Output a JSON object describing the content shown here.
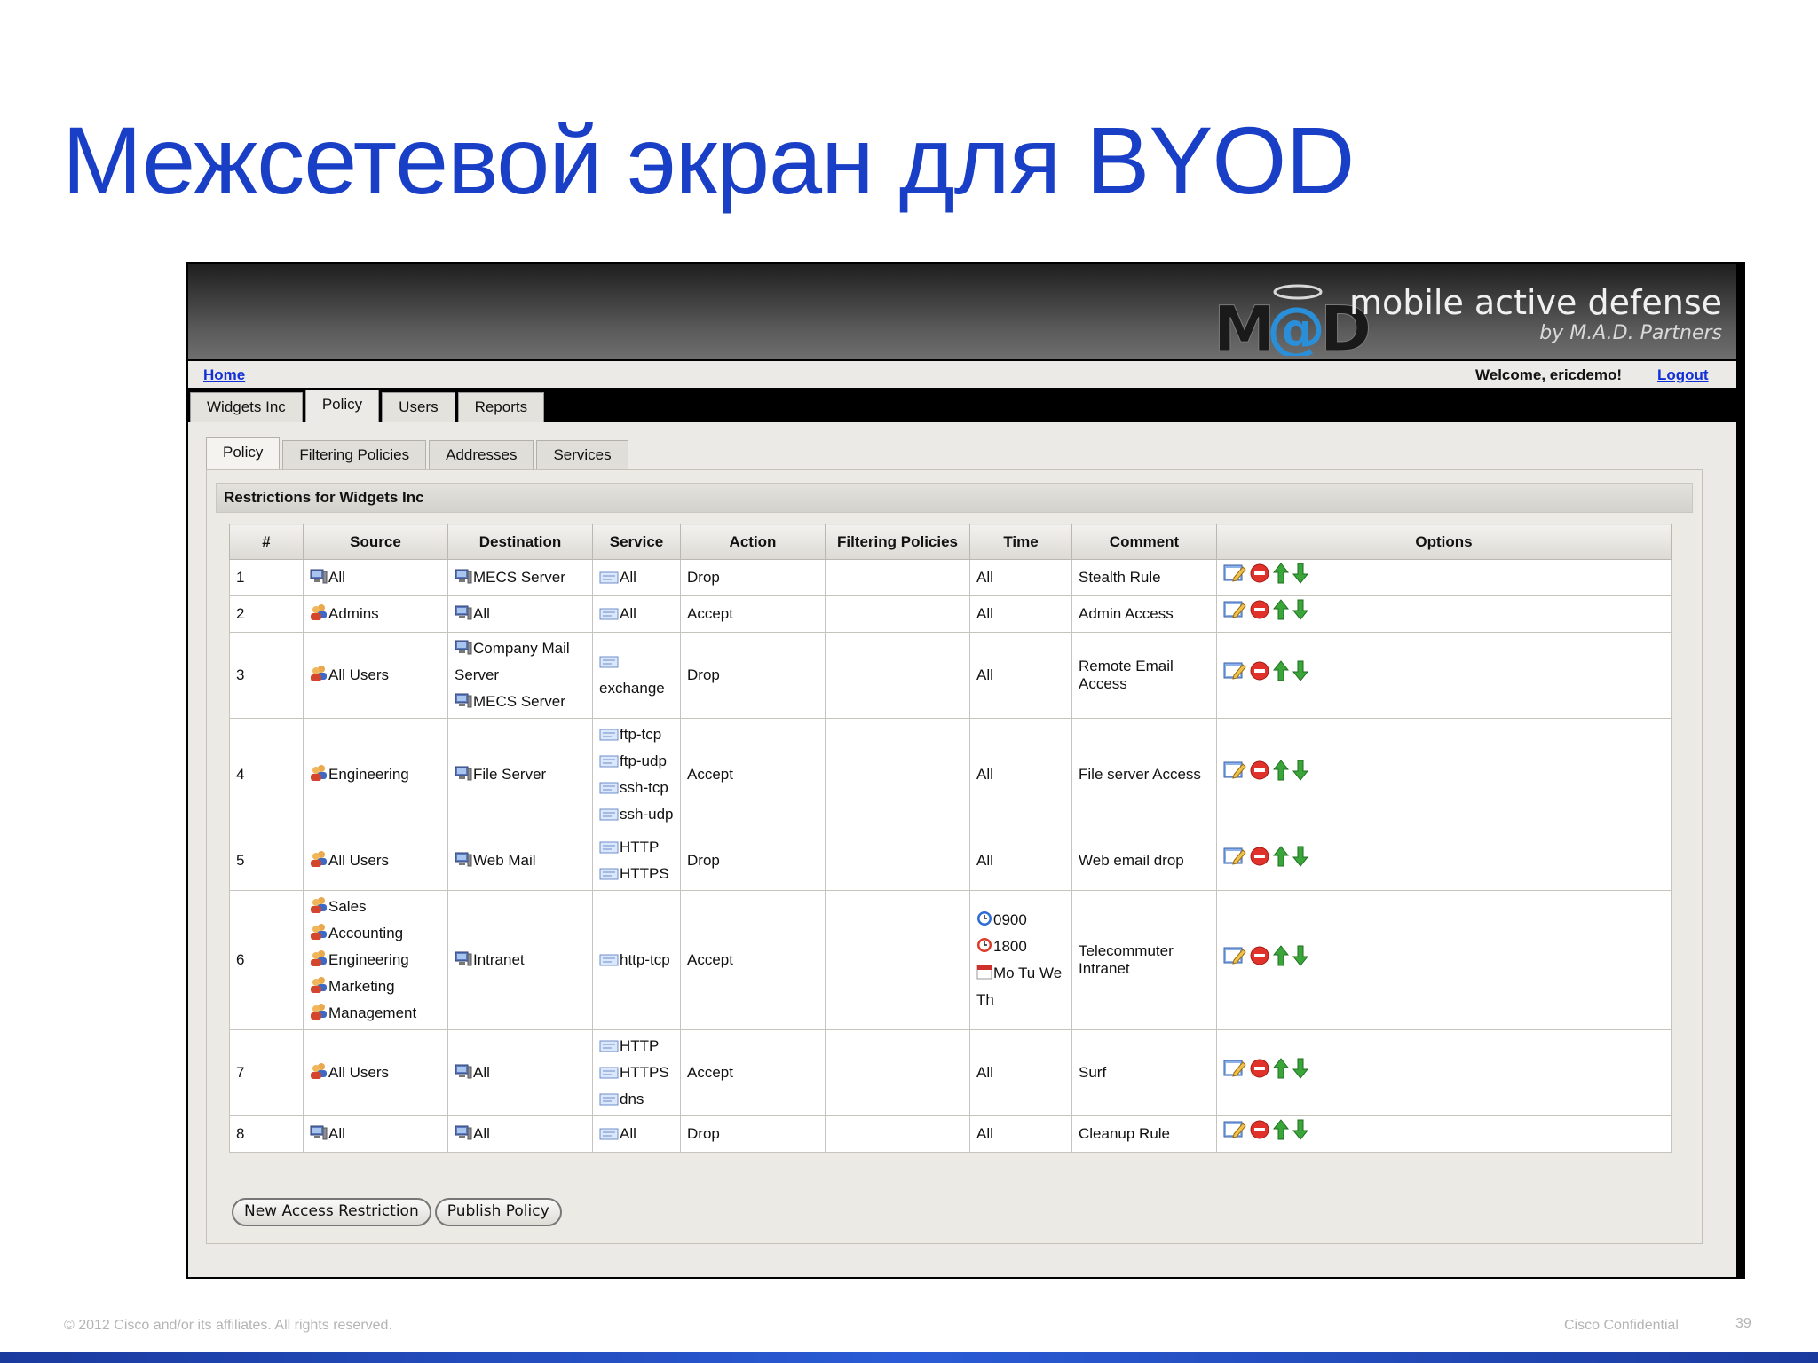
{
  "slide": {
    "title": "Межсетевой экран для BYOD",
    "footer_copyright": "© 2012 Cisco and/or its affiliates. All rights reserved.",
    "footer_confidential": "Cisco Confidential",
    "page_number": "39"
  },
  "app": {
    "logo_mark": "M@D",
    "logo_text": "mobile active defense",
    "logo_subtext": "by M.A.D. Partners",
    "home_link": "Home",
    "welcome": "Welcome, ericdemo!",
    "logout_link": "Logout",
    "top_tabs": [
      "Widgets Inc",
      "Policy",
      "Users",
      "Reports"
    ],
    "active_top_tab": "Policy",
    "sub_tabs": [
      "Policy",
      "Filtering Policies",
      "Addresses",
      "Services"
    ],
    "active_sub_tab": "Policy",
    "panel_title": "Restrictions for Widgets Inc",
    "columns": [
      "#",
      "Source",
      "Destination",
      "Service",
      "Action",
      "Filtering Policies",
      "Time",
      "Comment",
      "Options"
    ],
    "rows": [
      {
        "num": "1",
        "source": [
          {
            "icon": "computer-icon",
            "text": "All"
          }
        ],
        "destination": [
          {
            "icon": "computer-icon",
            "text": "MECS Server"
          }
        ],
        "service": [
          {
            "icon": "service-icon",
            "text": "All"
          }
        ],
        "action": "Drop",
        "filtering": "",
        "time": [
          {
            "icon": "",
            "text": "All"
          }
        ],
        "comment": "Stealth Rule"
      },
      {
        "num": "2",
        "source": [
          {
            "icon": "users-icon",
            "text": "Admins"
          }
        ],
        "destination": [
          {
            "icon": "computer-icon",
            "text": "All"
          }
        ],
        "service": [
          {
            "icon": "service-icon",
            "text": "All"
          }
        ],
        "action": "Accept",
        "filtering": "",
        "time": [
          {
            "icon": "",
            "text": "All"
          }
        ],
        "comment": "Admin Access"
      },
      {
        "num": "3",
        "source": [
          {
            "icon": "users-icon",
            "text": "All Users"
          }
        ],
        "destination": [
          {
            "icon": "computer-icon",
            "text": "Company Mail"
          },
          {
            "icon": "",
            "text": "Server"
          },
          {
            "icon": "computer-icon",
            "text": "MECS Server"
          }
        ],
        "service": [
          {
            "icon": "service-icon",
            "text": ""
          },
          {
            "icon": "",
            "text": "exchange"
          }
        ],
        "action": "Drop",
        "filtering": "",
        "time": [
          {
            "icon": "",
            "text": "All"
          }
        ],
        "comment": "Remote Email Access"
      },
      {
        "num": "4",
        "source": [
          {
            "icon": "users-icon",
            "text": "Engineering"
          }
        ],
        "destination": [
          {
            "icon": "computer-icon",
            "text": "File Server"
          }
        ],
        "service": [
          {
            "icon": "service-icon",
            "text": "ftp-tcp"
          },
          {
            "icon": "service-icon",
            "text": "ftp-udp"
          },
          {
            "icon": "service-icon",
            "text": "ssh-tcp"
          },
          {
            "icon": "service-icon",
            "text": "ssh-udp"
          }
        ],
        "action": "Accept",
        "filtering": "",
        "time": [
          {
            "icon": "",
            "text": "All"
          }
        ],
        "comment": "File server Access"
      },
      {
        "num": "5",
        "source": [
          {
            "icon": "users-icon",
            "text": "All Users"
          }
        ],
        "destination": [
          {
            "icon": "computer-icon",
            "text": "Web Mail"
          }
        ],
        "service": [
          {
            "icon": "service-icon",
            "text": "HTTP"
          },
          {
            "icon": "service-icon",
            "text": "HTTPS"
          }
        ],
        "action": "Drop",
        "filtering": "",
        "time": [
          {
            "icon": "",
            "text": "All"
          }
        ],
        "comment": "Web email drop"
      },
      {
        "num": "6",
        "source": [
          {
            "icon": "users-icon",
            "text": "Sales"
          },
          {
            "icon": "users-icon",
            "text": "Accounting"
          },
          {
            "icon": "users-icon",
            "text": "Engineering"
          },
          {
            "icon": "users-icon",
            "text": "Marketing"
          },
          {
            "icon": "users-icon",
            "text": "Management"
          }
        ],
        "destination": [
          {
            "icon": "computer-icon",
            "text": "Intranet"
          }
        ],
        "service": [
          {
            "icon": "service-icon",
            "text": "http-tcp"
          }
        ],
        "action": "Accept",
        "filtering": "",
        "time": [
          {
            "icon": "clock-blue-icon",
            "text": "0900"
          },
          {
            "icon": "clock-red-icon",
            "text": "1800"
          },
          {
            "icon": "calendar-icon",
            "text": "Mo Tu We"
          },
          {
            "icon": "",
            "text": "Th"
          }
        ],
        "comment": "Telecommuter Intranet"
      },
      {
        "num": "7",
        "source": [
          {
            "icon": "users-icon",
            "text": "All Users"
          }
        ],
        "destination": [
          {
            "icon": "computer-icon",
            "text": "All"
          }
        ],
        "service": [
          {
            "icon": "service-icon",
            "text": "HTTP"
          },
          {
            "icon": "service-icon",
            "text": "HTTPS"
          },
          {
            "icon": "service-icon",
            "text": "dns"
          }
        ],
        "action": "Accept",
        "filtering": "",
        "time": [
          {
            "icon": "",
            "text": "All"
          }
        ],
        "comment": "Surf"
      },
      {
        "num": "8",
        "source": [
          {
            "icon": "computer-icon",
            "text": "All"
          }
        ],
        "destination": [
          {
            "icon": "computer-icon",
            "text": "All"
          }
        ],
        "service": [
          {
            "icon": "service-icon",
            "text": "All"
          }
        ],
        "action": "Drop",
        "filtering": "",
        "time": [
          {
            "icon": "",
            "text": "All"
          }
        ],
        "comment": "Cleanup Rule"
      }
    ],
    "row_option_icons": [
      "edit-icon",
      "delete-icon",
      "move-up-icon",
      "move-down-icon"
    ],
    "buttons": {
      "new_restriction": "New Access Restriction",
      "publish_policy": "Publish Policy"
    },
    "colors": {
      "title": "#1a3fc7",
      "link": "#1230d8",
      "logo_at": "#2a8fd8"
    }
  }
}
